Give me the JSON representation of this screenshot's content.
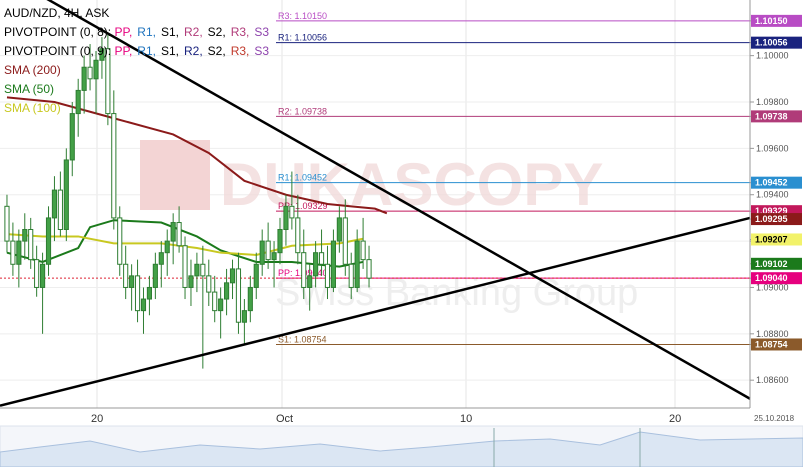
{
  "chart_data": {
    "type": "candlestick",
    "symbol": "AUD/NZD, 4H, ASK",
    "date_label": "25.10.2018",
    "watermark": {
      "brand": "DUKASCOPY",
      "tagline": "Swiss Banking Group"
    },
    "x_ticks": [
      "20",
      "Oct",
      "10",
      "20"
    ],
    "y_ticks": [
      "1.10150",
      "1.10056",
      "1.10000",
      "1.09800",
      "1.09738",
      "1.09600",
      "1.09452",
      "1.09400",
      "1.09329",
      "1.09295",
      "1.09207",
      "1.09200",
      "1.09102",
      "1.09040",
      "1.09000",
      "1.08800",
      "1.08754",
      "1.08600"
    ],
    "ylim": [
      1.0848,
      1.1024
    ],
    "legend": [
      {
        "name": "pivot-first",
        "label": "PIVOTPOINT (0, 8):",
        "tokens": [
          "PP",
          "R1",
          "S1",
          "R2",
          "S2",
          "R3",
          "S3"
        ],
        "colors": [
          "#e6007e",
          "#1e73be",
          "#000000",
          "#b03b79",
          "#000000",
          "#b03b79",
          "#8e44ad"
        ]
      },
      {
        "name": "pivot-second",
        "label": "PIVOTPOINT (0, 9):",
        "tokens": [
          "PP",
          "R1",
          "S1",
          "R2",
          "S2",
          "R3",
          "S3"
        ],
        "colors": [
          "#e6007e",
          "#1e73be",
          "#000000",
          "#1a237e",
          "#000000",
          "#c0392b",
          "#8e44ad"
        ]
      },
      {
        "name": "sma-200",
        "label": "SMA (200)",
        "color": "#8b1a1a"
      },
      {
        "name": "sma-50",
        "label": "SMA (50)",
        "color": "#1b7a1b"
      },
      {
        "name": "sma-100",
        "label": "SMA (100)",
        "color": "#c8c820"
      }
    ],
    "pivot_lines": [
      {
        "name": "r3",
        "label": "R3: 1.10150",
        "value": 1.1015,
        "color": "#b84cc4",
        "tag": "1.10150"
      },
      {
        "name": "r1-weekly",
        "label": "R1: 1.10056",
        "value": 1.10056,
        "color": "#1a237e",
        "tag": "1.10056"
      },
      {
        "name": "r2",
        "label": "R2: 1.09738",
        "value": 1.09738,
        "color": "#b03b79",
        "tag": "1.09738"
      },
      {
        "name": "r1",
        "label": "R1: 1.09452",
        "value": 1.09452,
        "color": "#2a8fd0",
        "tag": "1.09452"
      },
      {
        "name": "pp-weekly",
        "label": "PP: 1.09329",
        "value": 1.09329,
        "color": "#c2185b",
        "tag": "1.09329"
      },
      {
        "name": "pp",
        "label": "PP: 1.09040",
        "value": 1.0904,
        "color": "#e6007e",
        "tag": "1.09040"
      },
      {
        "name": "s1",
        "label": "S1: 1.08754",
        "value": 1.08754,
        "color": "#8b5a2b",
        "tag": "1.08754"
      }
    ],
    "value_tags": [
      {
        "name": "sma200-tag",
        "value": 1.09295,
        "text": "1.09295",
        "bg": "#8b1a1a",
        "fg": "#ffffff"
      },
      {
        "name": "sma100-tag",
        "value": 1.09207,
        "text": "1.09207",
        "bg": "#f2f26a",
        "fg": "#000000"
      },
      {
        "name": "sma50-tag",
        "value": 1.09102,
        "text": "1.09102",
        "bg": "#1b7a1b",
        "fg": "#ffffff"
      }
    ],
    "current_price": 1.0904,
    "trendlines": [
      {
        "name": "descending-trendline",
        "from": {
          "x": 0,
          "y": 1.1036
        },
        "to": {
          "x": 100,
          "y": 1.0852
        }
      },
      {
        "name": "ascending-trendline",
        "from": {
          "x": 0,
          "y": 1.0849
        },
        "to": {
          "x": 100,
          "y": 1.093
        }
      }
    ],
    "sma_200": [
      [
        0,
        1.0982
      ],
      [
        8,
        1.098
      ],
      [
        18,
        1.0973
      ],
      [
        28,
        1.0966
      ],
      [
        34,
        1.0958
      ],
      [
        40,
        1.0946
      ],
      [
        47,
        1.094
      ],
      [
        54,
        1.0936
      ],
      [
        58,
        1.0935
      ],
      [
        62,
        1.0934
      ],
      [
        64,
        1.0932
      ]
    ],
    "sma_50": [
      [
        0,
        1.0915
      ],
      [
        6,
        1.0911
      ],
      [
        12,
        1.0917
      ],
      [
        14,
        1.0926
      ],
      [
        18,
        1.0929
      ],
      [
        26,
        1.0928
      ],
      [
        32,
        1.0922
      ],
      [
        36,
        1.0916
      ],
      [
        42,
        1.0911
      ],
      [
        48,
        1.0911
      ],
      [
        56,
        1.0909
      ],
      [
        60,
        1.0911
      ]
    ],
    "sma_100": [
      [
        0,
        1.0923
      ],
      [
        6,
        1.0922
      ],
      [
        12,
        1.0922
      ],
      [
        18,
        1.0919
      ],
      [
        26,
        1.0919
      ],
      [
        32,
        1.0917
      ],
      [
        36,
        1.0915
      ],
      [
        42,
        1.0914
      ],
      [
        48,
        1.0918
      ],
      [
        56,
        1.0919
      ],
      [
        60,
        1.0921
      ]
    ],
    "candles": [
      [
        1.0935,
        1.094,
        1.0915,
        1.092
      ],
      [
        1.092,
        1.0928,
        1.0905,
        1.091
      ],
      [
        1.091,
        1.0925,
        1.09,
        1.092
      ],
      [
        1.092,
        1.0932,
        1.0912,
        1.0925
      ],
      [
        1.0925,
        1.093,
        1.0908,
        1.0912
      ],
      [
        1.0912,
        1.0918,
        1.0896,
        1.09
      ],
      [
        1.09,
        1.0915,
        1.088,
        1.091
      ],
      [
        1.091,
        1.0935,
        1.0905,
        1.093
      ],
      [
        1.093,
        1.0948,
        1.092,
        1.0942
      ],
      [
        1.0942,
        1.095,
        1.0922,
        1.0925
      ],
      [
        1.0925,
        1.096,
        1.092,
        1.0955
      ],
      [
        1.0955,
        1.098,
        1.0948,
        1.0975
      ],
      [
        1.0975,
        1.099,
        1.0965,
        1.0985
      ],
      [
        1.0985,
        1.1,
        1.0975,
        1.0995
      ],
      [
        1.0995,
        1.1005,
        1.0985,
        1.099
      ],
      [
        1.099,
        1.1002,
        1.0975,
        1.0998
      ],
      [
        1.0998,
        1.1008,
        1.099,
        1.1003
      ],
      [
        1.1003,
        1.101,
        1.097,
        1.0975
      ],
      [
        1.0975,
        1.0985,
        1.0925,
        1.093
      ],
      [
        1.093,
        1.0935,
        1.0905,
        1.091
      ],
      [
        1.091,
        1.0918,
        1.0895,
        1.09
      ],
      [
        1.09,
        1.091,
        1.089,
        1.0905
      ],
      [
        1.0905,
        1.0912,
        1.0885,
        1.089
      ],
      [
        1.089,
        1.09,
        1.088,
        1.0895
      ],
      [
        1.0895,
        1.0905,
        1.0888,
        1.09
      ],
      [
        1.09,
        1.0915,
        1.0895,
        1.091
      ],
      [
        1.091,
        1.092,
        1.09,
        1.0915
      ],
      [
        1.0915,
        1.0925,
        1.0905,
        1.092
      ],
      [
        1.092,
        1.0932,
        1.091,
        1.0928
      ],
      [
        1.0928,
        1.0935,
        1.0915,
        1.0918
      ],
      [
        1.0918,
        1.0922,
        1.0895,
        1.09
      ],
      [
        1.09,
        1.0912,
        1.0892,
        1.0905
      ],
      [
        1.0905,
        1.0915,
        1.0898,
        1.091
      ],
      [
        1.091,
        1.0918,
        1.0865,
        1.0905
      ],
      [
        1.0905,
        1.0912,
        1.0892,
        1.0898
      ],
      [
        1.0898,
        1.0905,
        1.0885,
        1.089
      ],
      [
        1.089,
        1.09,
        1.0878,
        1.0895
      ],
      [
        1.0895,
        1.0908,
        1.0888,
        1.0902
      ],
      [
        1.0902,
        1.0912,
        1.0895,
        1.0908
      ],
      [
        1.0908,
        1.0915,
        1.088,
        1.0885
      ],
      [
        1.0885,
        1.0895,
        1.0875,
        1.089
      ],
      [
        1.089,
        1.0905,
        1.0885,
        1.09
      ],
      [
        1.09,
        1.0915,
        1.0895,
        1.091
      ],
      [
        1.091,
        1.0925,
        1.0905,
        1.092
      ],
      [
        1.092,
        1.0928,
        1.0908,
        1.0912
      ],
      [
        1.0912,
        1.092,
        1.09,
        1.0915
      ],
      [
        1.0915,
        1.093,
        1.091,
        1.0925
      ],
      [
        1.0925,
        1.094,
        1.0918,
        1.0935
      ],
      [
        1.0935,
        1.095,
        1.0925,
        1.093
      ],
      [
        1.093,
        1.094,
        1.091,
        1.0915
      ],
      [
        1.0915,
        1.0925,
        1.0895,
        1.09
      ],
      [
        1.09,
        1.091,
        1.089,
        1.0905
      ],
      [
        1.0905,
        1.092,
        1.09,
        1.0915
      ],
      [
        1.0915,
        1.0925,
        1.0905,
        1.091
      ],
      [
        1.091,
        1.0918,
        1.0895,
        1.09
      ],
      [
        1.09,
        1.0925,
        1.0898,
        1.092
      ],
      [
        1.092,
        1.0935,
        1.0915,
        1.093
      ],
      [
        1.093,
        1.0938,
        1.0905,
        1.091
      ],
      [
        1.091,
        1.0915,
        1.0895,
        1.09
      ],
      [
        1.09,
        1.0925,
        1.0898,
        1.092
      ],
      [
        1.092,
        1.093,
        1.0908,
        1.0912
      ],
      [
        1.0912,
        1.0918,
        1.09,
        1.0904
      ]
    ]
  }
}
